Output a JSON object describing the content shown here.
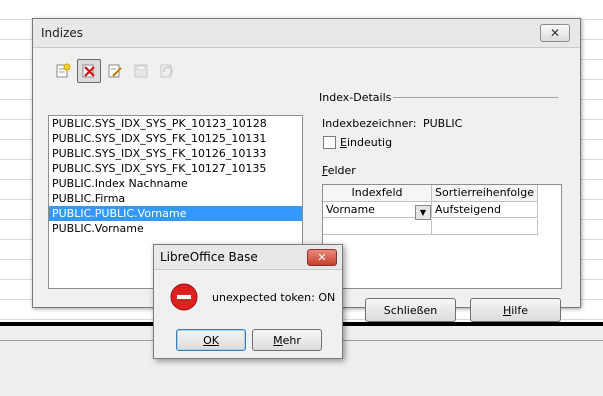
{
  "window": {
    "title": "Indizes",
    "close": "✕",
    "toolbar_icons": [
      "new-index-icon",
      "delete-index-icon",
      "rename-index-icon",
      "save-index-icon",
      "reset-index-icon"
    ]
  },
  "index_list": [
    "PUBLIC.SYS_IDX_SYS_PK_10123_10128",
    "PUBLIC.SYS_IDX_SYS_FK_10125_10131",
    "PUBLIC.SYS_IDX_SYS_FK_10126_10133",
    "PUBLIC.SYS_IDX_SYS_FK_10127_10135",
    "PUBLIC.Index Nachname",
    "PUBLIC.Firma",
    "PUBLIC.PUBLIC.Vorname",
    "PUBLIC.Vorname"
  ],
  "selected_index": "PUBLIC.PUBLIC.Vorname",
  "details": {
    "section_label": "Index-Details",
    "identifier_label": "Indexbezeichner:",
    "identifier_value": "PUBLIC",
    "unique_label_first": "E",
    "unique_label_rest": "indeutig",
    "unique_checked": false,
    "fields_label_first": "F",
    "fields_label_rest": "elder",
    "grid": {
      "headers": [
        "Indexfeld",
        "Sortierreihenfolge"
      ],
      "rows": [
        [
          "Vorname",
          "Aufsteigend"
        ]
      ]
    }
  },
  "buttons": {
    "close_label": "Schließen",
    "help_label_first": "H",
    "help_label_rest": "ilfe"
  },
  "dialog": {
    "title": "LibreOffice Base",
    "close": "✕",
    "message": "unexpected token: ON",
    "ok_label": "OK",
    "more_label_first": "M",
    "more_label_rest": "ehr"
  }
}
